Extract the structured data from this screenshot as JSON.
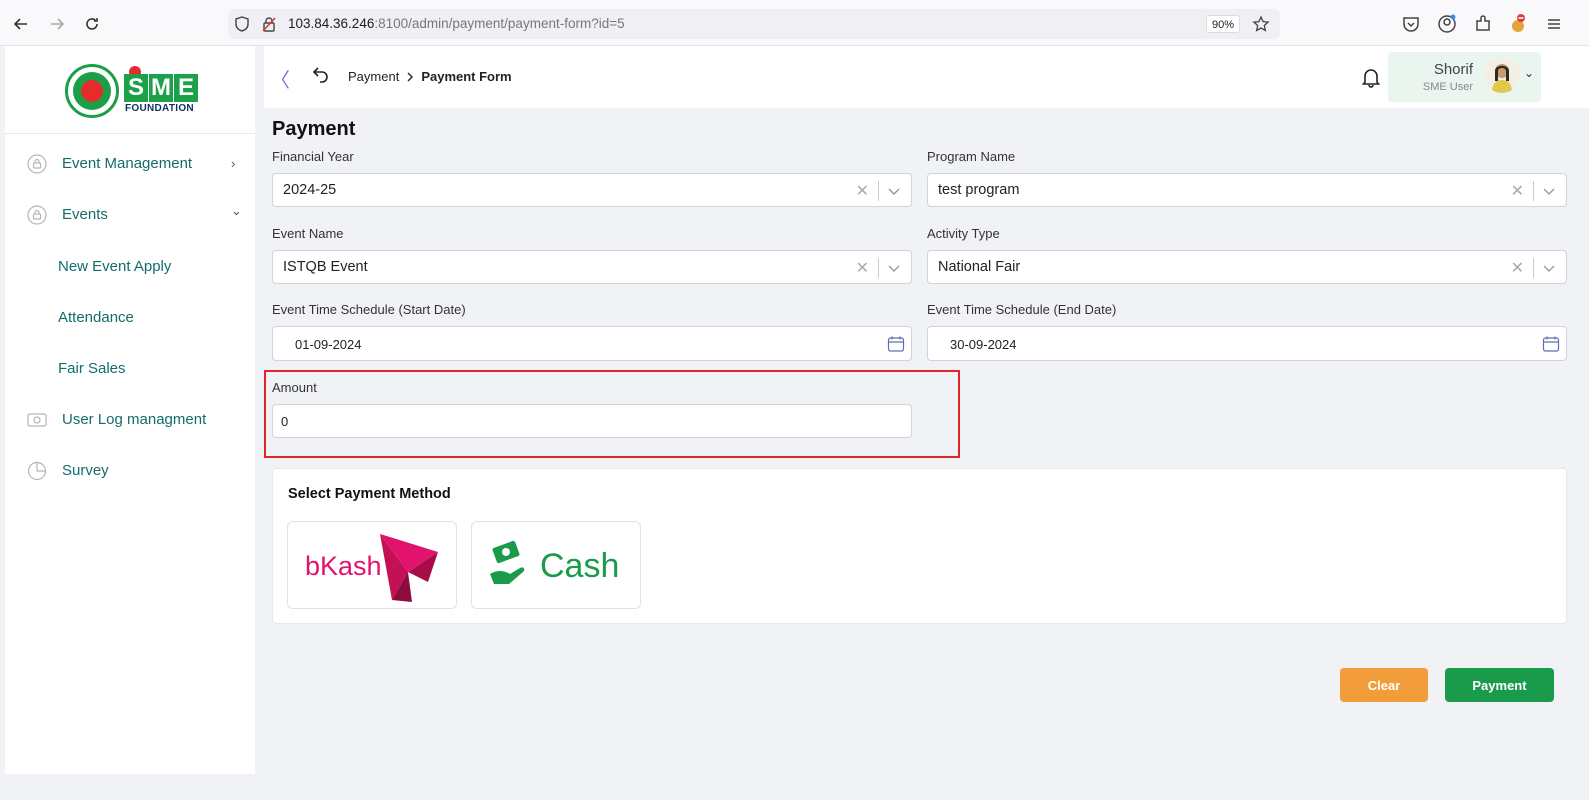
{
  "browser": {
    "url_host": "103.84.36.246",
    "url_rest": ":8100/admin/payment/payment-form?id=5",
    "zoom": "90%"
  },
  "sidebar": {
    "logo_letters": [
      "S",
      "M",
      "E"
    ],
    "logo_subtitle": "FOUNDATION",
    "items": [
      {
        "label": "Event Management",
        "icon": "lock-circle-icon",
        "arrow": "›"
      },
      {
        "label": "Events",
        "icon": "lock-circle-icon",
        "arrow": "⌄"
      },
      {
        "label": "User Log managment",
        "icon": "log-icon"
      },
      {
        "label": "Survey",
        "icon": "pie-chart-icon"
      }
    ],
    "submenu": [
      "New Event Apply",
      "Attendance",
      "Fair Sales"
    ]
  },
  "header": {
    "breadcrumb": [
      "Payment",
      "Payment Form"
    ],
    "user_name": "Shorif",
    "user_role": "SME User"
  },
  "form": {
    "title": "Payment",
    "financial_year": {
      "label": "Financial Year",
      "value": "2024-25"
    },
    "program_name": {
      "label": "Program Name",
      "value": "test program"
    },
    "event_name": {
      "label": "Event Name",
      "value": "ISTQB Event"
    },
    "activity_type": {
      "label": "Activity Type",
      "value": "National Fair"
    },
    "start_date": {
      "label": "Event Time Schedule (Start Date)",
      "value": "01-09-2024"
    },
    "end_date": {
      "label": "Event Time Schedule (End Date)",
      "value": "30-09-2024"
    },
    "amount": {
      "label": "Amount",
      "value": "0"
    },
    "payment_method": {
      "title": "Select Payment Method",
      "options": [
        "bKash",
        "Cash"
      ]
    },
    "clear_label": "Clear",
    "payment_label": "Payment"
  },
  "colors": {
    "brand_green": "#1a9b4b",
    "clear_orange": "#f29c3a",
    "highlight_red": "#e0242a",
    "bkash_pink": "#e2136e"
  }
}
